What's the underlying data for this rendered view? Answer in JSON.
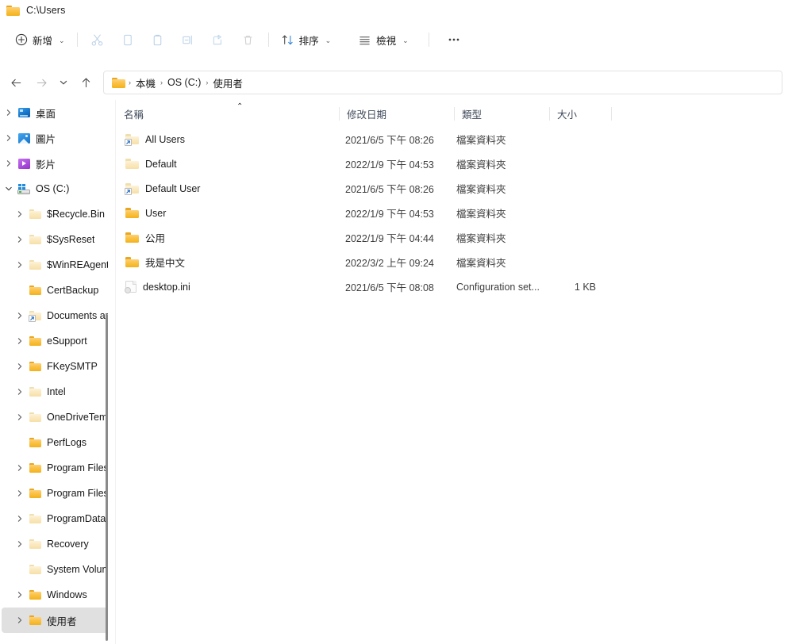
{
  "titlebar": {
    "title": "C:\\Users",
    "icon": "folder-icon"
  },
  "toolbar": {
    "new_label": "新增",
    "cut_icon": "scissors-icon",
    "copy_icon": "copy-icon",
    "paste_icon": "clipboard-icon",
    "rename_icon": "rename-icon",
    "share_icon": "share-icon",
    "delete_icon": "trash-icon",
    "sort_label": "排序",
    "sort_icon": "sort-arrows-icon",
    "view_label": "檢視",
    "view_icon": "view-list-icon",
    "more_label": "···"
  },
  "nav": {
    "back_icon": "arrow-left-icon",
    "forward_icon": "arrow-right-icon",
    "recent_icon": "chevron-down-icon",
    "up_icon": "arrow-up-icon"
  },
  "address": {
    "icon": "folder-icon",
    "crumbs": [
      "本機",
      "OS (C:)",
      "使用者"
    ],
    "separator": "›"
  },
  "sidebar": {
    "items": [
      {
        "label": "桌面",
        "icon": "desktop-icon",
        "expander": "chevron-right",
        "indent": 0,
        "selected": false,
        "shortcut": false
      },
      {
        "label": "圖片",
        "icon": "pictures-icon",
        "expander": "chevron-right",
        "indent": 0,
        "selected": false,
        "shortcut": false
      },
      {
        "label": "影片",
        "icon": "videos-icon",
        "expander": "chevron-right",
        "indent": 0,
        "selected": false,
        "shortcut": false
      },
      {
        "label": "OS (C:)",
        "icon": "drive-icon",
        "expander": "chevron-down",
        "indent": 0,
        "selected": false,
        "shortcut": false
      },
      {
        "label": "$Recycle.Bin",
        "icon": "folder-pale",
        "expander": "chevron-right",
        "indent": 1,
        "selected": false,
        "shortcut": false
      },
      {
        "label": "$SysReset",
        "icon": "folder-pale",
        "expander": "chevron-right",
        "indent": 1,
        "selected": false,
        "shortcut": false
      },
      {
        "label": "$WinREAgent",
        "icon": "folder-pale",
        "expander": "chevron-right",
        "indent": 1,
        "selected": false,
        "shortcut": false
      },
      {
        "label": "CertBackup",
        "icon": "folder-icon",
        "expander": "none",
        "indent": 1,
        "selected": false,
        "shortcut": false
      },
      {
        "label": "Documents and",
        "icon": "folder-pale",
        "expander": "chevron-right",
        "indent": 1,
        "selected": false,
        "shortcut": true
      },
      {
        "label": "eSupport",
        "icon": "folder-icon",
        "expander": "chevron-right",
        "indent": 1,
        "selected": false,
        "shortcut": false
      },
      {
        "label": "FKeySMTP",
        "icon": "folder-icon",
        "expander": "chevron-right",
        "indent": 1,
        "selected": false,
        "shortcut": false
      },
      {
        "label": "Intel",
        "icon": "folder-pale",
        "expander": "chevron-right",
        "indent": 1,
        "selected": false,
        "shortcut": false
      },
      {
        "label": "OneDriveTemp",
        "icon": "folder-pale",
        "expander": "chevron-right",
        "indent": 1,
        "selected": false,
        "shortcut": false
      },
      {
        "label": "PerfLogs",
        "icon": "folder-icon",
        "expander": "none",
        "indent": 1,
        "selected": false,
        "shortcut": false
      },
      {
        "label": "Program Files",
        "icon": "folder-icon",
        "expander": "chevron-right",
        "indent": 1,
        "selected": false,
        "shortcut": false
      },
      {
        "label": "Program Files",
        "icon": "folder-icon",
        "expander": "chevron-right",
        "indent": 1,
        "selected": false,
        "shortcut": false
      },
      {
        "label": "ProgramData",
        "icon": "folder-pale",
        "expander": "chevron-right",
        "indent": 1,
        "selected": false,
        "shortcut": false
      },
      {
        "label": "Recovery",
        "icon": "folder-pale",
        "expander": "chevron-right",
        "indent": 1,
        "selected": false,
        "shortcut": false
      },
      {
        "label": "System Volume",
        "icon": "folder-pale",
        "expander": "none",
        "indent": 1,
        "selected": false,
        "shortcut": false
      },
      {
        "label": "Windows",
        "icon": "folder-icon",
        "expander": "chevron-right",
        "indent": 1,
        "selected": false,
        "shortcut": false
      },
      {
        "label": "使用者",
        "icon": "folder-icon",
        "expander": "chevron-right",
        "indent": 1,
        "selected": true,
        "shortcut": false
      }
    ]
  },
  "filelist": {
    "columns": [
      {
        "label": "名稱",
        "sorted": "asc"
      },
      {
        "label": "修改日期",
        "sorted": ""
      },
      {
        "label": "類型",
        "sorted": ""
      },
      {
        "label": "大小",
        "sorted": ""
      }
    ],
    "rows": [
      {
        "name": "All Users",
        "date": "2021/6/5 下午 08:26",
        "type": "檔案資料夾",
        "size": "",
        "icon": "folder-pale",
        "shortcut": true
      },
      {
        "name": "Default",
        "date": "2022/1/9 下午 04:53",
        "type": "檔案資料夾",
        "size": "",
        "icon": "folder-pale",
        "shortcut": false
      },
      {
        "name": "Default User",
        "date": "2021/6/5 下午 08:26",
        "type": "檔案資料夾",
        "size": "",
        "icon": "folder-pale",
        "shortcut": true
      },
      {
        "name": "User",
        "date": "2022/1/9 下午 04:53",
        "type": "檔案資料夾",
        "size": "",
        "icon": "folder-icon",
        "shortcut": false
      },
      {
        "name": "公用",
        "date": "2022/1/9 下午 04:44",
        "type": "檔案資料夾",
        "size": "",
        "icon": "folder-icon",
        "shortcut": false
      },
      {
        "name": "我是中文",
        "date": "2022/3/2 上午 09:24",
        "type": "檔案資料夾",
        "size": "",
        "icon": "folder-icon",
        "shortcut": false
      },
      {
        "name": "desktop.ini",
        "date": "2021/6/5 下午 08:08",
        "type": "Configuration set...",
        "size": "1 KB",
        "icon": "ini-file-icon",
        "shortcut": false
      }
    ]
  },
  "colors": {
    "accent": "#0b5cae",
    "folder": "#f3b21b",
    "selection": "#e0e0e0",
    "header_text": "#404b5c"
  }
}
